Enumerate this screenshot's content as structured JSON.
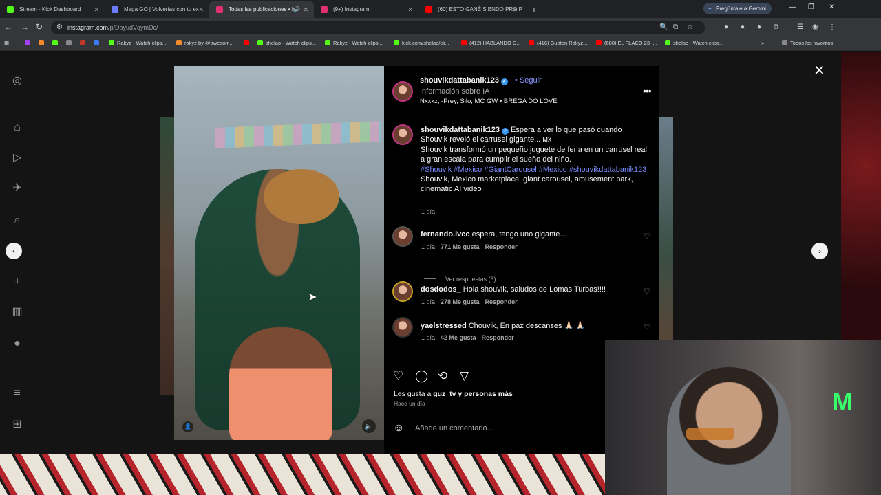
{
  "browser": {
    "tabs": [
      {
        "title": "Stream - Kick Dashboard",
        "color": "#53fc18"
      },
      {
        "title": "Mega GO | Volverías con tu ex",
        "color": "#6b7cff"
      },
      {
        "title": "Todas las publicaciones • In",
        "color": "#e1306c",
        "active": true
      },
      {
        "title": "(9+) Instagram",
        "color": "#e1306c"
      },
      {
        "title": "(60) ESTO GANÉ SIENDO PRO P",
        "color": "#ff0000"
      }
    ],
    "gemini_label": "Pregúntale a Gemini",
    "url_host": "instagram.com",
    "url_path": "/p/DbyudVqymDc/",
    "bookmarks": [
      {
        "label": "Rakyz - Watch clips...",
        "color": "#53fc18"
      },
      {
        "label": "rakyz by @awesom...",
        "color": "#f28b2a"
      },
      {
        "label": "shelao - Watch clips...",
        "color": "#53fc18"
      },
      {
        "label": "Rakyz - Watch clips...",
        "color": "#53fc18"
      },
      {
        "label": "kick.com/shelao/cli...",
        "color": "#53fc18"
      },
      {
        "label": "(412) HABLANDO D...",
        "color": "#ff0000"
      },
      {
        "label": "(416) Guaton Rakyz...",
        "color": "#ff0000"
      },
      {
        "label": "(680) EL FLACO 23 -...",
        "color": "#ff0000"
      },
      {
        "label": "shelao - Watch clips...",
        "color": "#53fc18"
      }
    ],
    "all_bookmarks": "Todos los favoritos"
  },
  "post": {
    "username": "shouvikdattabanik123",
    "follow": "Seguir",
    "subtitle": "Información sobre IA",
    "music": "Nxxkz, -Prey, Silo, MC GW • BREGA DO LOVE",
    "caption": {
      "intro": "Espera a ver lo que pasó cuando Shouvik reveló el carrusel gigante... ᴍx",
      "body": "Shouvik transformó un pequeño juguete de feria en un carrusel real a gran escala para cumplir el sueño del niño.",
      "tags": "#Shouvik #Mexico #GiantCarousel #Mexico #shouvikdattabanik123",
      "keywords": "Shouvik, Mexico marketplace, giant carousel, amusement park, cinematic AI video",
      "time": "1 día"
    },
    "comments": [
      {
        "user": "fernando.lvcc",
        "text": "espera, tengo uno gigante...",
        "time": "1 día",
        "likes": "771 Me gusta",
        "reply": "Responder"
      },
      {
        "user": "dosdodos_",
        "text": "Hola shouvik, saludos de Lomas Turbas!!!!",
        "time": "1 día",
        "likes": "278 Me gusta",
        "reply": "Responder"
      },
      {
        "user": "yaelstressed",
        "text": "Chouvik, En paz descanses 🙏🏻 🙏🏻",
        "time": "1 día",
        "likes": "42 Me gusta",
        "reply": "Responder"
      }
    ],
    "view_replies": "Ver respuestas (3)",
    "likes_prefix": "Les gusta a ",
    "likes_user": "guz_tv",
    "likes_suffix": " y personas más",
    "posted": "Hace un día",
    "comment_placeholder": "Añade un comentario..."
  }
}
